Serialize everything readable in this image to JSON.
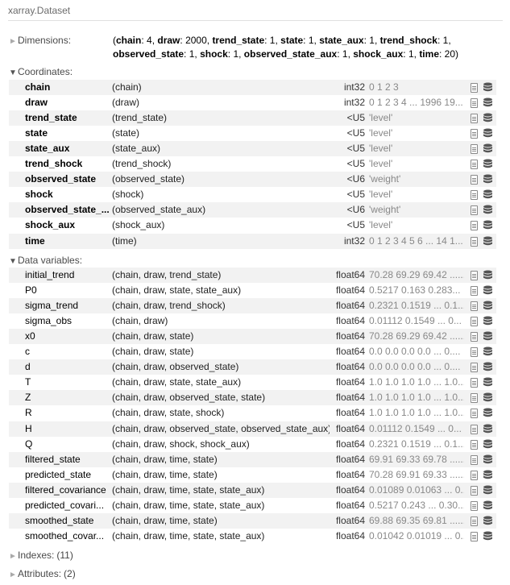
{
  "title": "xarray.Dataset",
  "dimensions": {
    "label": "Dimensions:",
    "items": [
      {
        "name": "chain",
        "size": "4"
      },
      {
        "name": "draw",
        "size": "2000"
      },
      {
        "name": "trend_state",
        "size": "1"
      },
      {
        "name": "state",
        "size": "1"
      },
      {
        "name": "state_aux",
        "size": "1"
      },
      {
        "name": "trend_shock",
        "size": "1"
      },
      {
        "name": "observed_state",
        "size": "1"
      },
      {
        "name": "shock",
        "size": "1"
      },
      {
        "name": "observed_state_aux",
        "size": "1"
      },
      {
        "name": "shock_aux",
        "size": "1"
      },
      {
        "name": "time",
        "size": "20"
      }
    ]
  },
  "coordinates": {
    "label": "Coordinates:",
    "rows": [
      {
        "name": "chain",
        "dims": "(chain)",
        "dtype": "int32",
        "preview": "0 1 2 3"
      },
      {
        "name": "draw",
        "dims": "(draw)",
        "dtype": "int32",
        "preview": "0 1 2 3 4 ... 1996 19..."
      },
      {
        "name": "trend_state",
        "dims": "(trend_state)",
        "dtype": "<U5",
        "preview": "'level'"
      },
      {
        "name": "state",
        "dims": "(state)",
        "dtype": "<U5",
        "preview": "'level'"
      },
      {
        "name": "state_aux",
        "dims": "(state_aux)",
        "dtype": "<U5",
        "preview": "'level'"
      },
      {
        "name": "trend_shock",
        "dims": "(trend_shock)",
        "dtype": "<U5",
        "preview": "'level'"
      },
      {
        "name": "observed_state",
        "dims": "(observed_state)",
        "dtype": "<U6",
        "preview": "'weight'"
      },
      {
        "name": "shock",
        "dims": "(shock)",
        "dtype": "<U5",
        "preview": "'level'"
      },
      {
        "name": "observed_state_...",
        "dims": "(observed_state_aux)",
        "dtype": "<U6",
        "preview": "'weight'"
      },
      {
        "name": "shock_aux",
        "dims": "(shock_aux)",
        "dtype": "<U5",
        "preview": "'level'"
      },
      {
        "name": "time",
        "dims": "(time)",
        "dtype": "int32",
        "preview": "0 1 2 3 4 5 6 ... 14 1..."
      }
    ]
  },
  "data_variables": {
    "label": "Data variables:",
    "rows": [
      {
        "name": "initial_trend",
        "dims": "(chain, draw, trend_state)",
        "dtype": "float64",
        "preview": "70.28 69.29 69.42 ......"
      },
      {
        "name": "P0",
        "dims": "(chain, draw, state, state_aux)",
        "dtype": "float64",
        "preview": "0.5217 0.163 0.283..."
      },
      {
        "name": "sigma_trend",
        "dims": "(chain, draw, trend_shock)",
        "dtype": "float64",
        "preview": "0.2321 0.1519 ... 0.1..."
      },
      {
        "name": "sigma_obs",
        "dims": "(chain, draw)",
        "dtype": "float64",
        "preview": "0.01112 0.1549 ... 0..."
      },
      {
        "name": "x0",
        "dims": "(chain, draw, state)",
        "dtype": "float64",
        "preview": "70.28 69.29 69.42 ......"
      },
      {
        "name": "c",
        "dims": "(chain, draw, state)",
        "dtype": "float64",
        "preview": "0.0 0.0 0.0 0.0 ... 0...."
      },
      {
        "name": "d",
        "dims": "(chain, draw, observed_state)",
        "dtype": "float64",
        "preview": "0.0 0.0 0.0 0.0 ... 0...."
      },
      {
        "name": "T",
        "dims": "(chain, draw, state, state_aux)",
        "dtype": "float64",
        "preview": "1.0 1.0 1.0 1.0 ... 1.0..."
      },
      {
        "name": "Z",
        "dims": "(chain, draw, observed_state, state)",
        "dtype": "float64",
        "preview": "1.0 1.0 1.0 1.0 ... 1.0..."
      },
      {
        "name": "R",
        "dims": "(chain, draw, state, shock)",
        "dtype": "float64",
        "preview": "1.0 1.0 1.0 1.0 ... 1.0..."
      },
      {
        "name": "H",
        "dims": "(chain, draw, observed_state, observed_state_aux)",
        "dtype": "float64",
        "preview": "0.01112 0.1549 ... 0..."
      },
      {
        "name": "Q",
        "dims": "(chain, draw, shock, shock_aux)",
        "dtype": "float64",
        "preview": "0.2321 0.1519 ... 0.1..."
      },
      {
        "name": "filtered_state",
        "dims": "(chain, draw, time, state)",
        "dtype": "float64",
        "preview": "69.91 69.33 69.78 ......"
      },
      {
        "name": "predicted_state",
        "dims": "(chain, draw, time, state)",
        "dtype": "float64",
        "preview": "70.28 69.91 69.33 ......"
      },
      {
        "name": "filtered_covariance",
        "dims": "(chain, draw, time, state, state_aux)",
        "dtype": "float64",
        "preview": "0.01089 0.01063 ... 0..."
      },
      {
        "name": "predicted_covari...",
        "dims": "(chain, draw, time, state, state_aux)",
        "dtype": "float64",
        "preview": "0.5217 0.243 ... 0.30..."
      },
      {
        "name": "smoothed_state",
        "dims": "(chain, draw, time, state)",
        "dtype": "float64",
        "preview": "69.88 69.35 69.81 ......"
      },
      {
        "name": "smoothed_covar...",
        "dims": "(chain, draw, time, state, state_aux)",
        "dtype": "float64",
        "preview": "0.01042 0.01019 ... 0..."
      }
    ]
  },
  "indexes": {
    "label": "Indexes:",
    "count": "(11)"
  },
  "attributes": {
    "label": "Attributes:",
    "count": "(2)"
  },
  "icons": {
    "attrs": "file-icon",
    "data": "database-icon"
  },
  "colors": {
    "stripe": "#f2f2f2",
    "muted": "#888888",
    "rule": "#e0e0e0"
  }
}
